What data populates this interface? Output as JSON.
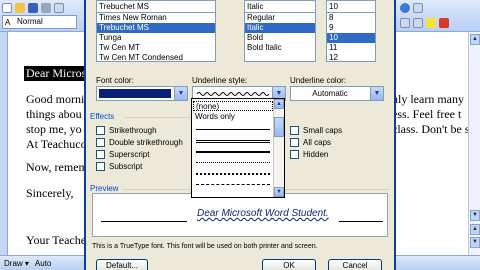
{
  "word": {
    "style_value": "Normal",
    "style_glyph": "A",
    "status": {
      "draw_label": "Draw ▾",
      "autoshapes_label": "Auto"
    },
    "document_lines": [
      "Dear Microsoft Word Student,",
      "Good morning! This is a computer class where you will not only learn many",
      "things about Microsoft Word, but you will also have success.  Feel free to",
      "stop me, you're welcome to ask questions at any time in class.  Don't be shy.",
      "At Teachucomp, we'll take care of you.",
      "Now, remember that learning is fun!",
      "Sincerely,",
      "Your Teacher"
    ],
    "visible_fragments": {
      "line1": "Dear Microso",
      "line2_left": "Good morni",
      "line2_right": "nly learn many",
      "line3_left": "things abou",
      "line3_right": "ess.  Feel free t",
      "line4_left": "stop me, yo",
      "line4_right": "class.  Don't be s",
      "line5_left": "At Teachuco",
      "line6_left": "Now, remem",
      "line7_left": "Sincerely,",
      "line8_left": "Your Teache"
    }
  },
  "dialog": {
    "font_list": {
      "current": "Trebuchet MS",
      "items": [
        "Times New Roman",
        "Trebuchet MS",
        "Tunga",
        "Tw Cen MT",
        "Tw Cen MT Condensed"
      ]
    },
    "style_list": {
      "current": "Italic",
      "items": [
        "Regular",
        "Italic",
        "Bold",
        "Bold Italic"
      ]
    },
    "size_list": {
      "current": "10",
      "items": [
        "8",
        "9",
        "10",
        "11",
        "12"
      ]
    },
    "font_color_label": "Font color:",
    "underline_style_label": "Underline style:",
    "underline_color_label": "Underline color:",
    "underline_color_value": "Automatic",
    "effects_label": "Effects",
    "effects": [
      "Strikethrough",
      "Double strikethrough",
      "Superscript",
      "Subscript"
    ],
    "effects_right": [
      "Small caps",
      "All caps",
      "Hidden"
    ],
    "preview_label": "Preview",
    "preview_text": "Dear Microsoft Word Student.",
    "truetype_note": "This is a TrueType font. This font will be used on both printer and screen.",
    "buttons": {
      "default": "Default...",
      "ok": "OK",
      "cancel": "Cancel"
    },
    "underline_options": [
      "(none)",
      "Words only"
    ]
  },
  "colors": {
    "font_color": "#0a1f7a",
    "selection": "#316ac5",
    "dialog_bg": "#ece9d8",
    "title_blue": "#0046d5"
  }
}
